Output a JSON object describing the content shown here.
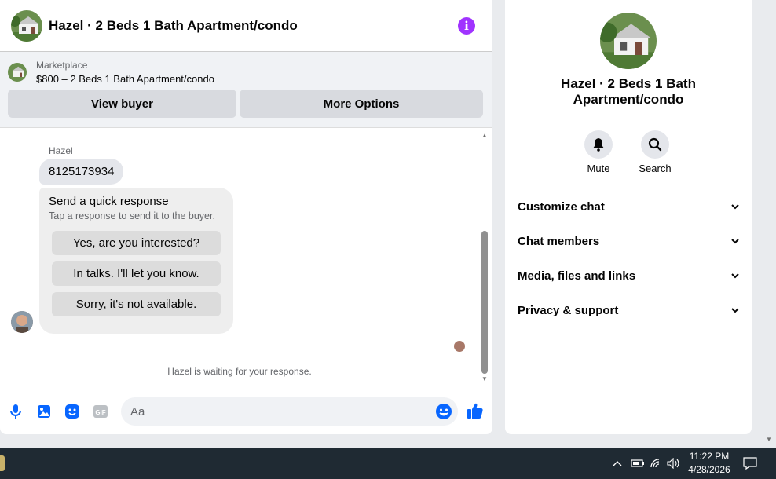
{
  "header": {
    "title": "Hazel · 2 Beds 1 Bath Apartment/condo"
  },
  "marketplace": {
    "label": "Marketplace",
    "listing": "$800 – 2 Beds 1 Bath Apartment/condo",
    "view_buyer": "View buyer",
    "more_options": "More Options"
  },
  "messages": {
    "sender": "Hazel",
    "phone": "8125173934",
    "quick_title": "Send a quick response",
    "quick_sub": "Tap a response to send it to the buyer.",
    "responses": [
      "Yes, are you interested?",
      "In talks. I'll let you know.",
      "Sorry, it's not available."
    ],
    "waiting": "Hazel is waiting for your response."
  },
  "composer": {
    "placeholder": "Aa"
  },
  "details": {
    "title": "Hazel · 2 Beds 1 Bath Apartment/condo",
    "mute": "Mute",
    "search": "Search",
    "sections": [
      "Customize chat",
      "Chat members",
      "Media, files and links",
      "Privacy & support"
    ]
  },
  "taskbar": {
    "time": "11:22 PM",
    "date": "4/28/2026"
  },
  "colors": {
    "accent": "#0866ff",
    "info": "#a033ff",
    "taskbar": "#1f2a33"
  }
}
